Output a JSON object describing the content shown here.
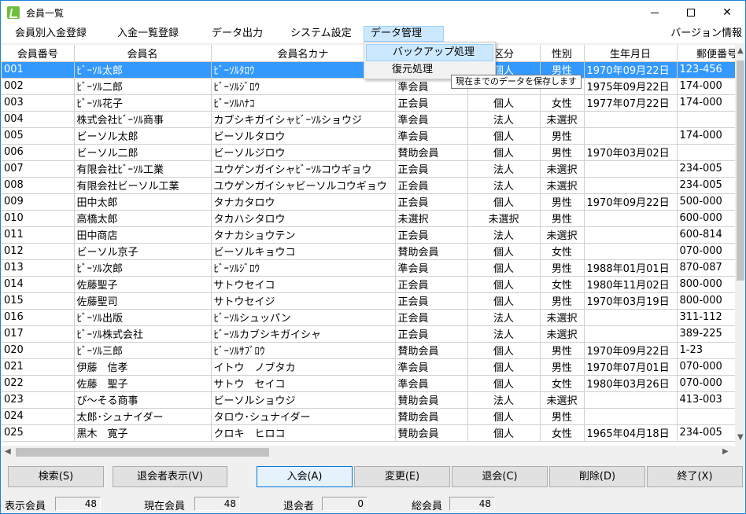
{
  "window": {
    "title": "会員一覧"
  },
  "menu": {
    "items": [
      "会員別入金登録",
      "入金一覧登録",
      "データ出力",
      "システム設定",
      "データ管理"
    ],
    "version": "バージョン情報"
  },
  "dropdown": {
    "items": [
      "バックアップ処理",
      "復元処理"
    ],
    "tooltip": "現在までのデータを保存します"
  },
  "table": {
    "headers": [
      "会員番号",
      "会員名",
      "会員名カナ",
      "",
      "区分",
      "性別",
      "生年月日",
      "郵便番号"
    ],
    "rows": [
      [
        "001",
        "ﾋﾞｰｿﾙ太郎",
        "ﾋﾞｰｿﾙﾀﾛｳ",
        "",
        "個人",
        "男性",
        "1970年09月22日",
        "123-456"
      ],
      [
        "002",
        "ﾋﾞｰｿﾙ二郎",
        "ﾋﾞｰｿﾙｼﾞﾛｳ",
        "準会員",
        "",
        "",
        "1975年09月22日",
        "174-000"
      ],
      [
        "003",
        "ﾋﾞｰｿﾙ花子",
        "ﾋﾞｰｿﾙﾊﾅｺ",
        "正会員",
        "個人",
        "女性",
        "1977年07月22日",
        "174-000"
      ],
      [
        "004",
        "株式会社ﾋﾞｰｿﾙ商事",
        "カブシキガイシャﾋﾞｰｿﾙショウジ",
        "準会員",
        "法人",
        "未選択",
        "",
        ""
      ],
      [
        "005",
        "ビーソル太郎",
        "ビーソルタロウ",
        "準会員",
        "個人",
        "男性",
        "",
        "174-000"
      ],
      [
        "006",
        "ビーソル二郎",
        "ビーソルジロウ",
        "賛助会員",
        "個人",
        "男性",
        "1970年03月02日",
        ""
      ],
      [
        "007",
        "有限会社ﾋﾞｰｿﾙ工業",
        "ユウゲンガイシャﾋﾞｰｿﾙコウギョウ",
        "正会員",
        "法人",
        "未選択",
        "",
        "234-005"
      ],
      [
        "008",
        "有限会社ビーソル工業",
        "ユウゲンガイシャビーソルコウギョウ",
        "正会員",
        "法人",
        "未選択",
        "",
        "234-005"
      ],
      [
        "009",
        "田中太郎",
        "タナカタロウ",
        "正会員",
        "個人",
        "男性",
        "1970年09月22日",
        "500-000"
      ],
      [
        "010",
        "高橋太郎",
        "タカハシタロウ",
        "未選択",
        "未選択",
        "男性",
        "",
        "600-000"
      ],
      [
        "011",
        "田中商店",
        "タナカショウテン",
        "正会員",
        "法人",
        "未選択",
        "",
        "600-814"
      ],
      [
        "012",
        "ビーソル京子",
        "ビーソルキョウコ",
        "賛助会員",
        "個人",
        "女性",
        "",
        "070-000"
      ],
      [
        "013",
        "ﾋﾞｰｿﾙ次郎",
        "ﾋﾞｰｿﾙｼﾞﾛｳ",
        "準会員",
        "個人",
        "男性",
        "1988年01月01日",
        "870-087"
      ],
      [
        "014",
        "佐藤聖子",
        "サトウセイコ",
        "正会員",
        "個人",
        "女性",
        "1980年11月02日",
        "800-000"
      ],
      [
        "015",
        "佐藤聖司",
        "サトウセイジ",
        "正会員",
        "個人",
        "男性",
        "1970年03月19日",
        "800-000"
      ],
      [
        "016",
        "ﾋﾞｰｿﾙ出版",
        "ﾋﾞｰｿﾙシュッパン",
        "正会員",
        "法人",
        "未選択",
        "",
        "311-112"
      ],
      [
        "017",
        "ﾋﾞｰｿﾙ株式会社",
        "ﾋﾞｰｿﾙカブシキガイシャ",
        "正会員",
        "法人",
        "未選択",
        "",
        "389-225"
      ],
      [
        "020",
        "ﾋﾞｰｿﾙ三郎",
        "ﾋﾞｰｿﾙｻﾌﾞﾛｳ",
        "賛助会員",
        "個人",
        "男性",
        "1970年09月22日",
        "1-23"
      ],
      [
        "021",
        "伊藤　信孝",
        "イトウ　ノブタカ",
        "準会員",
        "個人",
        "男性",
        "1970年07月01日",
        "070-000"
      ],
      [
        "022",
        "佐藤　聖子",
        "サトウ　セイコ",
        "準会員",
        "個人",
        "女性",
        "1980年03月26日",
        "070-000"
      ],
      [
        "023",
        "び～そる商事",
        "ビーソルショウジ",
        "賛助会員",
        "法人",
        "未選択",
        "",
        "413-003"
      ],
      [
        "024",
        "太郎･シュナイダー",
        "タロウ･シュナイダー",
        "賛助会員",
        "個人",
        "男性",
        "",
        ""
      ],
      [
        "025",
        "黒木　寛子",
        "クロキ　ヒロコ",
        "賛助会員",
        "個人",
        "女性",
        "1965年04月18日",
        "234-005"
      ]
    ]
  },
  "buttons": [
    "検索(S)",
    "退会者表示(V)",
    "入会(A)",
    "変更(E)",
    "退会(C)",
    "削除(D)",
    "終了(X)"
  ],
  "status": [
    {
      "label": "表示会員",
      "value": "48"
    },
    {
      "label": "現在会員",
      "value": "48"
    },
    {
      "label": "退会者",
      "value": "0"
    },
    {
      "label": "総会員",
      "value": "48"
    }
  ],
  "colors": {
    "selection": "#3399ff",
    "menu_highlight": "#cce8ff",
    "window_border": "#1883d7"
  }
}
